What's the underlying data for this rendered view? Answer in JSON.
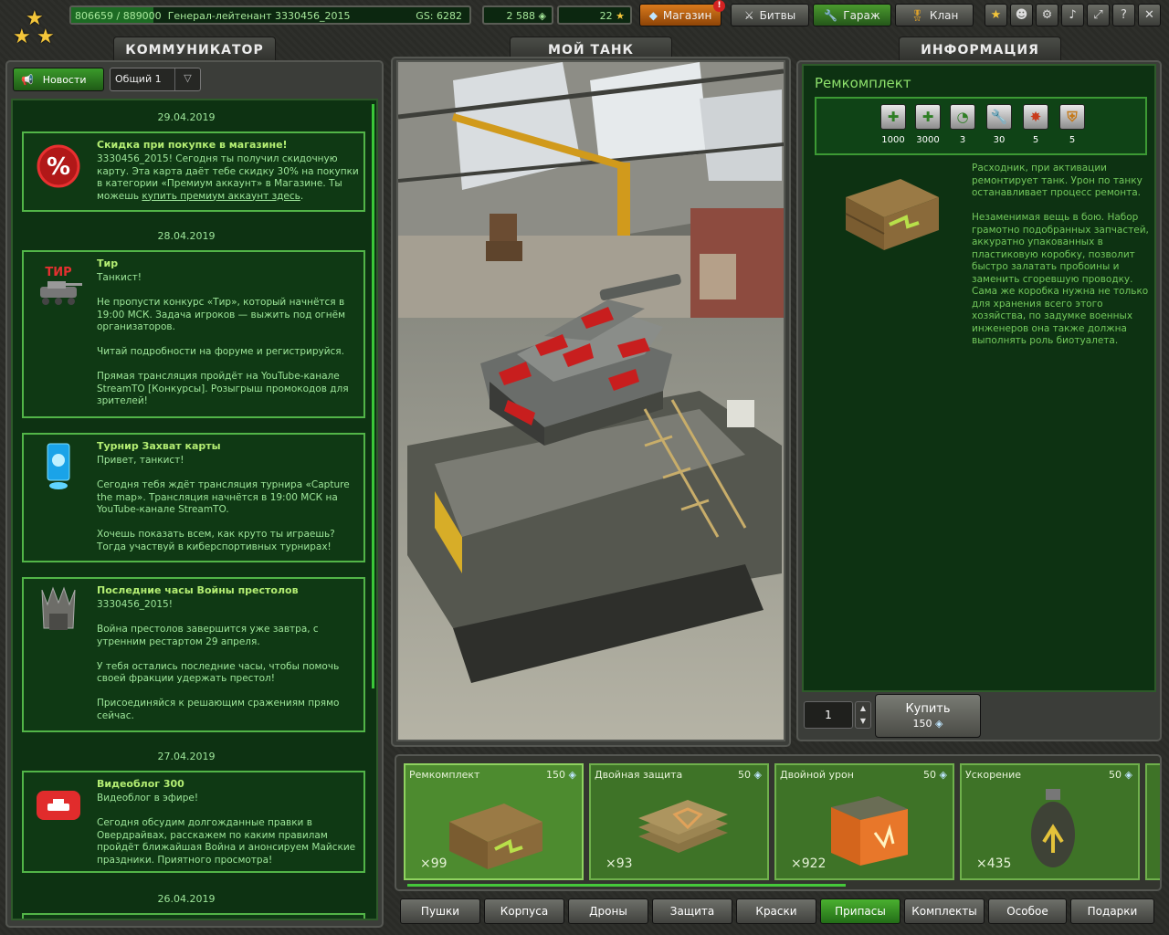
{
  "topbar": {
    "xp": "806659 / 889000",
    "rank_user": "Генерал-лейтенант 3330456_2015",
    "gs": "GS: 6282",
    "crystals": "2 588",
    "stars": "22",
    "shop": "Магазин",
    "shop_badge": "!",
    "battles": "Битвы",
    "garage": "Гараж",
    "clan": "Клан",
    "help": "?"
  },
  "tabs": {
    "communicator": "КОММУНИКАТОР",
    "my_tank": "МОЙ ТАНК",
    "info": "ИНФОРМАЦИЯ"
  },
  "communicator": {
    "news_button": "Новости",
    "channel": "Общий 1",
    "items": [
      {
        "date": "29.04.2019",
        "title": "Скидка при покупке в магазине!",
        "body": "3330456_2015! Сегодня ты получил скидочную карту. Эта карта даёт тебе скидку 30% на покупки в категории «Премиум аккаунт» в Магазине. Ты можешь ",
        "link": "купить премиум аккаунт здесь",
        "tail": "."
      },
      {
        "date": "28.04.2019",
        "title": "Тир",
        "icon_label": "ТИР",
        "body": "Танкист!\n\nНе пропусти конкурс «Тир», который начнётся в 19:00 МСК. Задача игроков — выжить под огнём организаторов.\n\nЧитай подробности на форуме и регистрируйся.\n\nПрямая трансляция пройдёт на YouTube-канале StreamTO [Конкурсы]. Розыгрыш промокодов для зрителей!"
      },
      {
        "title": "Турнир Захват карты",
        "body": "Привет, танкист!\n\n Сегодня тебя ждёт трансляция турнира «Capture the map». Трансляция начнётся в 19:00 МСК на YouTube-канале StreamTO.\n\nХочешь показать всем, как круто ты играешь? Тогда участвуй в киберспортивных турнирах!"
      },
      {
        "title": "Последние часы Войны престолов",
        "body": "3330456_2015!\n\nВойна престолов завершится уже завтра, с утренним рестартом 29 апреля.\n\nУ тебя остались последние часы, чтобы помочь своей фракции удержать престол!\n\n Присоединяйся к решающим сражениям прямо сейчас."
      },
      {
        "date": "27.04.2019",
        "title": "Видеоблог 300",
        "body": "Видеоблог в эфире!\n\nСегодня обсудим долгожданные правки в Овердрайвах, расскажем по каким правилам пройдёт ближайшая Война и анонсируем Майские праздники. Приятного просмотра!"
      },
      {
        "date": "26.04.2019"
      }
    ]
  },
  "info": {
    "title": "Ремкомплект",
    "stats": [
      "1000",
      "3000",
      "3",
      "30",
      "5",
      "5"
    ],
    "description": "Расходник, при активации ремонтирует танк. Урон по танку останавливает процесс ремонта.\n\nНезаменимая вещь в бою. Набор грамотно подобранных запчастей, аккуратно упакованных в пластиковую коробку, позволит быстро залатать пробоины и заменить сгоревшую проводку. Сама же коробка нужна не только для хранения всего этого хозяйства, по задумке военных инженеров она также должна выполнять роль биотуалета.",
    "quantity": "1",
    "buy_label": "Купить",
    "buy_price": "150"
  },
  "shop": {
    "items": [
      {
        "name": "Ремкомплект",
        "price": "150",
        "count": "×99"
      },
      {
        "name": "Двойная защита",
        "price": "50",
        "count": "×93"
      },
      {
        "name": "Двойной урон",
        "price": "50",
        "count": "×922"
      },
      {
        "name": "Ускорение",
        "price": "50",
        "count": "×435"
      }
    ],
    "categories": [
      "Пушки",
      "Корпуса",
      "Дроны",
      "Защита",
      "Краски",
      "Припасы",
      "Комплекты",
      "Особое",
      "Подарки"
    ]
  },
  "colors": {
    "accent_green": "#52b548",
    "shop_orange": "#d97a1c"
  }
}
